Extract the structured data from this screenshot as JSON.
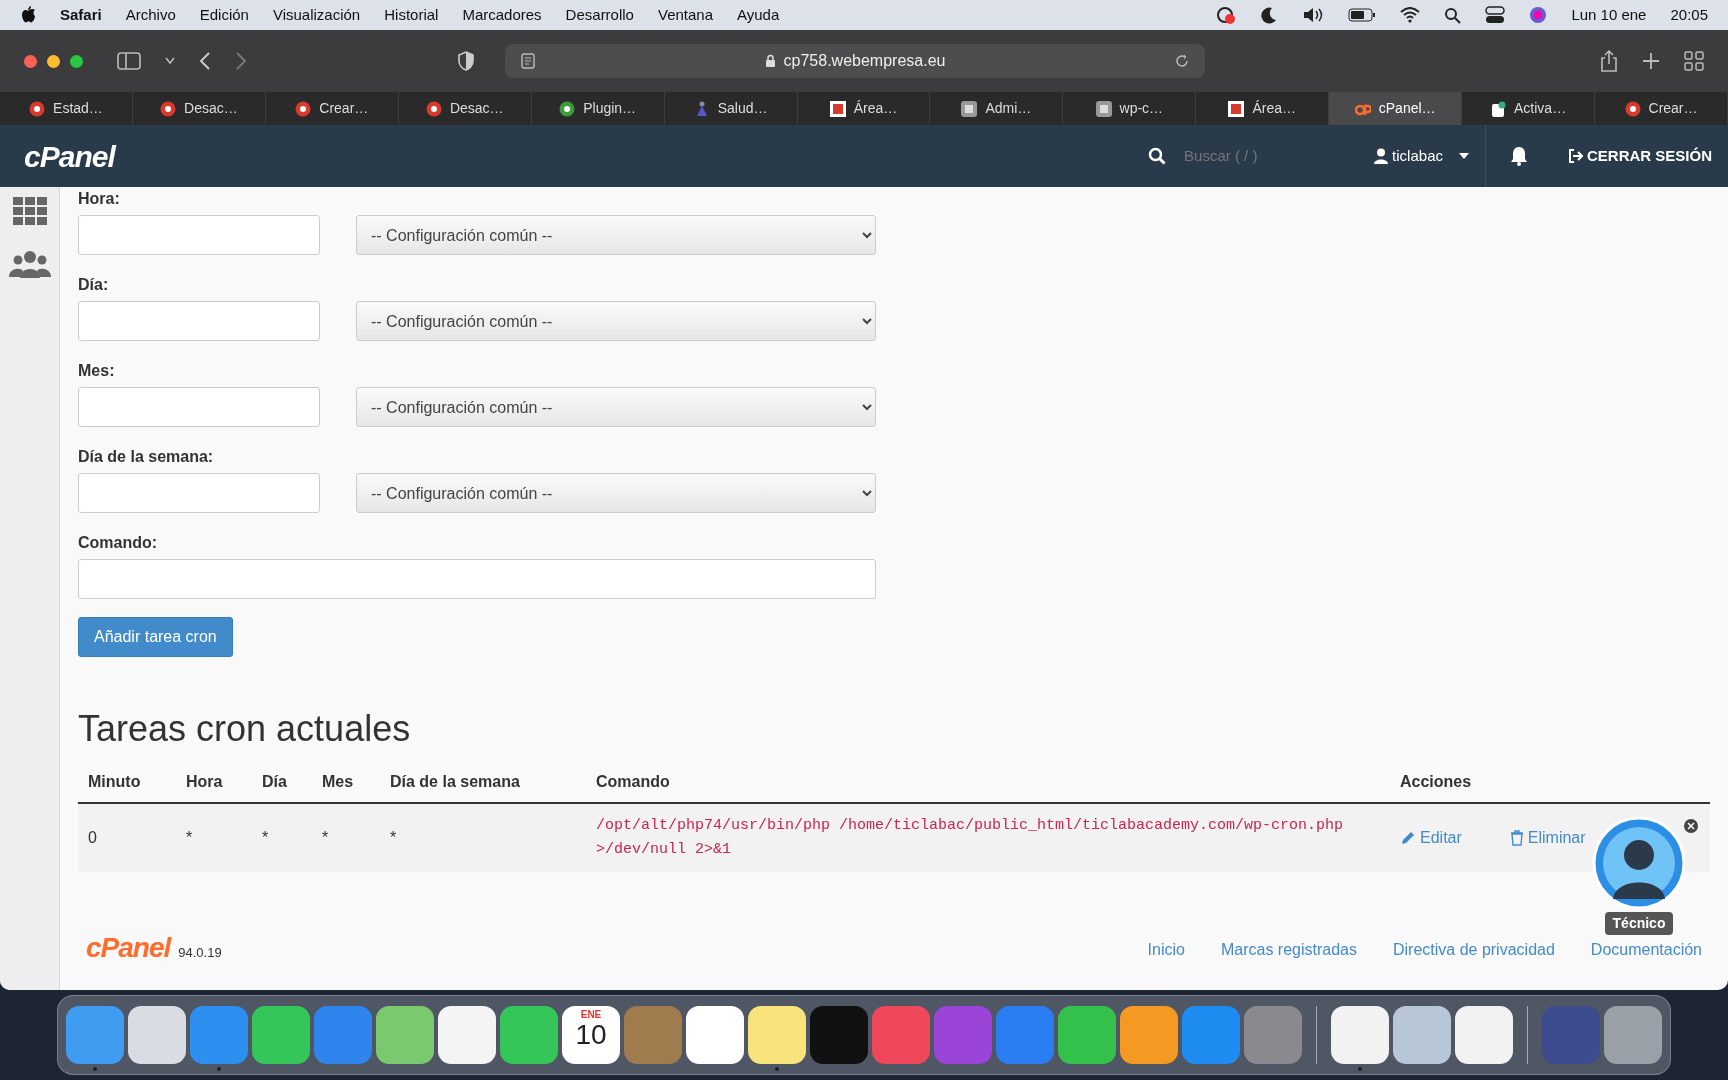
{
  "menubar": {
    "app": "Safari",
    "menus": [
      "Archivo",
      "Edición",
      "Visualización",
      "Historial",
      "Marcadores",
      "Desarrollo",
      "Ventana",
      "Ayuda"
    ],
    "date": "Lun 10 ene",
    "time": "20:05"
  },
  "browser": {
    "url": "cp758.webempresa.eu",
    "tabs": [
      {
        "title": "Estad…",
        "kind": "webempresa",
        "selected": false
      },
      {
        "title": "Desac…",
        "kind": "webempresa",
        "selected": false
      },
      {
        "title": "Crear…",
        "kind": "webempresa",
        "selected": false
      },
      {
        "title": "Desac…",
        "kind": "webempresa",
        "selected": false
      },
      {
        "title": "Plugin…",
        "kind": "plugin",
        "selected": false
      },
      {
        "title": "Salud…",
        "kind": "health",
        "selected": false
      },
      {
        "title": "Área…",
        "kind": "area",
        "selected": false
      },
      {
        "title": "Admi…",
        "kind": "wordpress",
        "selected": false
      },
      {
        "title": "wp-c…",
        "kind": "wordpress",
        "selected": false
      },
      {
        "title": "Área…",
        "kind": "area",
        "selected": false
      },
      {
        "title": "cPanel…",
        "kind": "cpanel",
        "selected": true
      },
      {
        "title": "Activa…",
        "kind": "document",
        "selected": false
      },
      {
        "title": "Crear…",
        "kind": "webempresa",
        "selected": false
      }
    ]
  },
  "header": {
    "logo": "cPanel",
    "search_placeholder": "Buscar ( / )",
    "user": "ticlabac",
    "logout": "CERRAR SESIÓN"
  },
  "form": {
    "fields": [
      {
        "label": "Hora:",
        "select": "-- Configuración común --"
      },
      {
        "label": "Día:",
        "select": "-- Configuración común --"
      },
      {
        "label": "Mes:",
        "select": "-- Configuración común --"
      },
      {
        "label": "Día de la semana:",
        "select": "-- Configuración común --"
      }
    ],
    "command_label": "Comando:",
    "submit": "Añadir tarea cron"
  },
  "table": {
    "title": "Tareas cron actuales",
    "columns": [
      "Minuto",
      "Hora",
      "Día",
      "Mes",
      "Día de la semana",
      "Comando",
      "Acciones"
    ],
    "rows": [
      {
        "cells": [
          "0",
          "*",
          "*",
          "*",
          "*"
        ],
        "command": "/opt/alt/php74/usr/bin/php /home/ticlabac/public_html/ticlabacademy.com/wp-cron.php >/dev/null 2>&1",
        "edit": "Editar",
        "delete": "Eliminar"
      }
    ]
  },
  "footer": {
    "logo": "cPanel",
    "version": "94.0.19",
    "links": [
      "Inicio",
      "Marcas registradas",
      "Directiva de privacidad",
      "Documentación"
    ]
  },
  "assistant": {
    "label": "Técnico"
  },
  "dock": [
    {
      "kind": "finder",
      "running": true
    },
    {
      "kind": "launchpad",
      "running": false
    },
    {
      "kind": "safari",
      "running": true
    },
    {
      "kind": "messages",
      "running": false
    },
    {
      "kind": "mail",
      "running": false
    },
    {
      "kind": "maps",
      "running": false
    },
    {
      "kind": "photos",
      "running": false
    },
    {
      "kind": "facetime",
      "running": false
    },
    {
      "kind": "calendar",
      "running": false,
      "month": "ENE",
      "day": "10"
    },
    {
      "kind": "contacts",
      "running": false
    },
    {
      "kind": "reminders",
      "running": false
    },
    {
      "kind": "notes",
      "running": true
    },
    {
      "kind": "tv",
      "running": false
    },
    {
      "kind": "music",
      "running": false
    },
    {
      "kind": "podcasts",
      "running": false
    },
    {
      "kind": "keynote",
      "running": false
    },
    {
      "kind": "numbers",
      "running": false
    },
    {
      "kind": "pages",
      "running": false
    },
    {
      "kind": "appstore",
      "running": false
    },
    {
      "kind": "settings",
      "running": false
    },
    {
      "kind": "separator"
    },
    {
      "kind": "chrome",
      "running": true
    },
    {
      "kind": "preview",
      "running": false
    },
    {
      "kind": "textedit",
      "running": false
    },
    {
      "kind": "separator"
    },
    {
      "kind": "document",
      "running": false
    },
    {
      "kind": "trash",
      "running": false
    }
  ]
}
